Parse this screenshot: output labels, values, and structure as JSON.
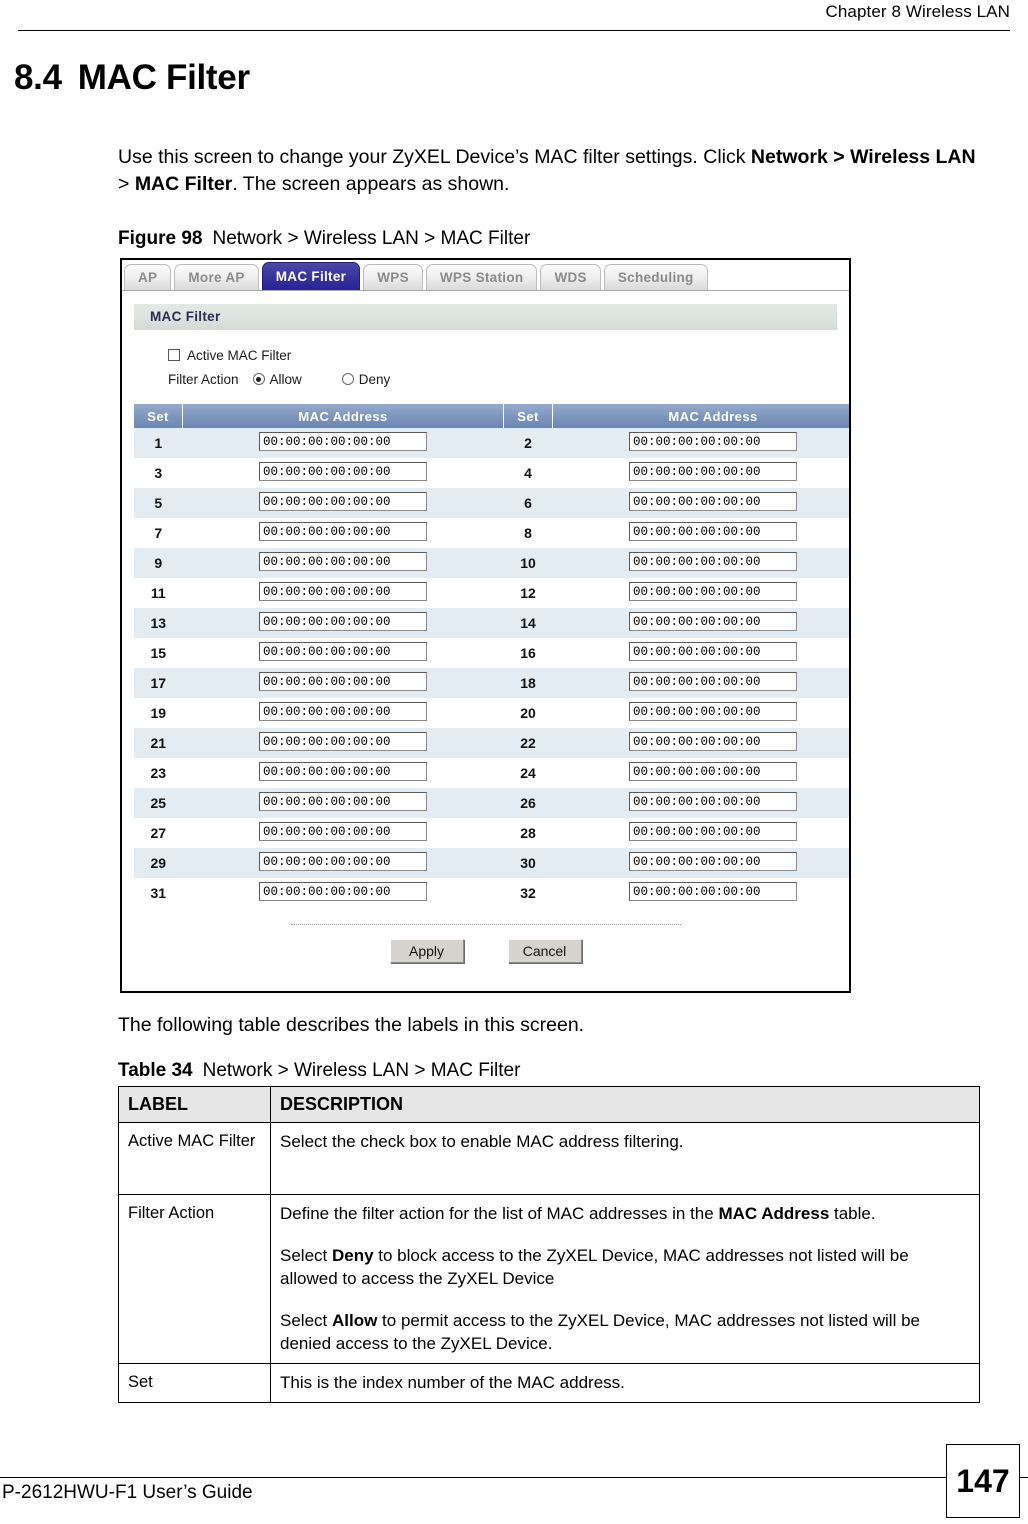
{
  "header": {
    "chapter": "Chapter 8 Wireless LAN"
  },
  "heading": {
    "number": "8.4",
    "title": "MAC Filter"
  },
  "intro": {
    "part1": "Use this screen to change your ZyXEL Device’s MAC filter settings. Click ",
    "bold1": "Network > Wireless LAN",
    "mid": " > ",
    "bold2": "MAC Filter",
    "part2": ". The screen appears as shown."
  },
  "figure": {
    "label": "Figure 98",
    "title": "Network > Wireless LAN > MAC Filter"
  },
  "screenshot": {
    "tabs": [
      {
        "label": "AP",
        "active": false
      },
      {
        "label": "More AP",
        "active": false
      },
      {
        "label": "MAC Filter",
        "active": true
      },
      {
        "label": "WPS",
        "active": false
      },
      {
        "label": "WPS Station",
        "active": false
      },
      {
        "label": "WDS",
        "active": false
      },
      {
        "label": "Scheduling",
        "active": false
      }
    ],
    "section_title": "MAC Filter",
    "active_filter": {
      "label": "Active MAC Filter",
      "checked": false
    },
    "filter_action": {
      "label": "Filter Action",
      "options": [
        {
          "label": "Allow",
          "selected": true
        },
        {
          "label": "Deny",
          "selected": false
        }
      ]
    },
    "table": {
      "headers": [
        "Set",
        "MAC Address",
        "Set",
        "MAC Address"
      ],
      "default_mac": "00:00:00:00:00:00",
      "rows": [
        {
          "left_set": "1",
          "left_mac": "00:00:00:00:00:00",
          "right_set": "2",
          "right_mac": "00:00:00:00:00:00",
          "shaded": true
        },
        {
          "left_set": "3",
          "left_mac": "00:00:00:00:00:00",
          "right_set": "4",
          "right_mac": "00:00:00:00:00:00",
          "shaded": false
        },
        {
          "left_set": "5",
          "left_mac": "00:00:00:00:00:00",
          "right_set": "6",
          "right_mac": "00:00:00:00:00:00",
          "shaded": true
        },
        {
          "left_set": "7",
          "left_mac": "00:00:00:00:00:00",
          "right_set": "8",
          "right_mac": "00:00:00:00:00:00",
          "shaded": false
        },
        {
          "left_set": "9",
          "left_mac": "00:00:00:00:00:00",
          "right_set": "10",
          "right_mac": "00:00:00:00:00:00",
          "shaded": true
        },
        {
          "left_set": "11",
          "left_mac": "00:00:00:00:00:00",
          "right_set": "12",
          "right_mac": "00:00:00:00:00:00",
          "shaded": false
        },
        {
          "left_set": "13",
          "left_mac": "00:00:00:00:00:00",
          "right_set": "14",
          "right_mac": "00:00:00:00:00:00",
          "shaded": true
        },
        {
          "left_set": "15",
          "left_mac": "00:00:00:00:00:00",
          "right_set": "16",
          "right_mac": "00:00:00:00:00:00",
          "shaded": false
        },
        {
          "left_set": "17",
          "left_mac": "00:00:00:00:00:00",
          "right_set": "18",
          "right_mac": "00:00:00:00:00:00",
          "shaded": true
        },
        {
          "left_set": "19",
          "left_mac": "00:00:00:00:00:00",
          "right_set": "20",
          "right_mac": "00:00:00:00:00:00",
          "shaded": false
        },
        {
          "left_set": "21",
          "left_mac": "00:00:00:00:00:00",
          "right_set": "22",
          "right_mac": "00:00:00:00:00:00",
          "shaded": true
        },
        {
          "left_set": "23",
          "left_mac": "00:00:00:00:00:00",
          "right_set": "24",
          "right_mac": "00:00:00:00:00:00",
          "shaded": false
        },
        {
          "left_set": "25",
          "left_mac": "00:00:00:00:00:00",
          "right_set": "26",
          "right_mac": "00:00:00:00:00:00",
          "shaded": true
        },
        {
          "left_set": "27",
          "left_mac": "00:00:00:00:00:00",
          "right_set": "28",
          "right_mac": "00:00:00:00:00:00",
          "shaded": false
        },
        {
          "left_set": "29",
          "left_mac": "00:00:00:00:00:00",
          "right_set": "30",
          "right_mac": "00:00:00:00:00:00",
          "shaded": true
        },
        {
          "left_set": "31",
          "left_mac": "00:00:00:00:00:00",
          "right_set": "32",
          "right_mac": "00:00:00:00:00:00",
          "shaded": false
        }
      ]
    },
    "buttons": {
      "apply": "Apply",
      "cancel": "Cancel"
    },
    "colors": {
      "active_tab": "#35329b",
      "table_header": "#7e97bf",
      "row_shade": "#e3ebf3",
      "section_bar": "#dde3de"
    }
  },
  "follow_text": "The following table describes the labels in this screen.",
  "desc_table": {
    "label": "Table 34",
    "title": "Network > Wireless LAN > MAC Filter",
    "headers": [
      "LABEL",
      "DESCRIPTION"
    ],
    "rows": [
      {
        "label": "Active MAC Filter",
        "desc_paragraphs": [
          {
            "segments": [
              {
                "text": "Select the check box to enable MAC address filtering.",
                "bold": false
              }
            ]
          }
        ]
      },
      {
        "label": "Filter Action",
        "desc_paragraphs": [
          {
            "segments": [
              {
                "text": "Define the filter action for the list of MAC addresses in the ",
                "bold": false
              },
              {
                "text": "MAC Address",
                "bold": true
              },
              {
                "text": " table.",
                "bold": false
              }
            ]
          },
          {
            "segments": [
              {
                "text": "Select ",
                "bold": false
              },
              {
                "text": "Deny",
                "bold": true
              },
              {
                "text": " to block access to the ZyXEL Device, MAC addresses not listed will be allowed to access the ZyXEL Device",
                "bold": false
              }
            ]
          },
          {
            "segments": [
              {
                "text": "Select ",
                "bold": false
              },
              {
                "text": "Allow",
                "bold": true
              },
              {
                "text": " to permit access to the ZyXEL Device, MAC addresses not listed will be denied access to the ZyXEL Device.",
                "bold": false
              }
            ]
          }
        ]
      },
      {
        "label": "Set",
        "desc_paragraphs": [
          {
            "segments": [
              {
                "text": "This is the index number of the MAC address.",
                "bold": false
              }
            ]
          }
        ]
      }
    ]
  },
  "footer": {
    "guide": "P-2612HWU-F1 User’s Guide",
    "page_number": "147"
  }
}
